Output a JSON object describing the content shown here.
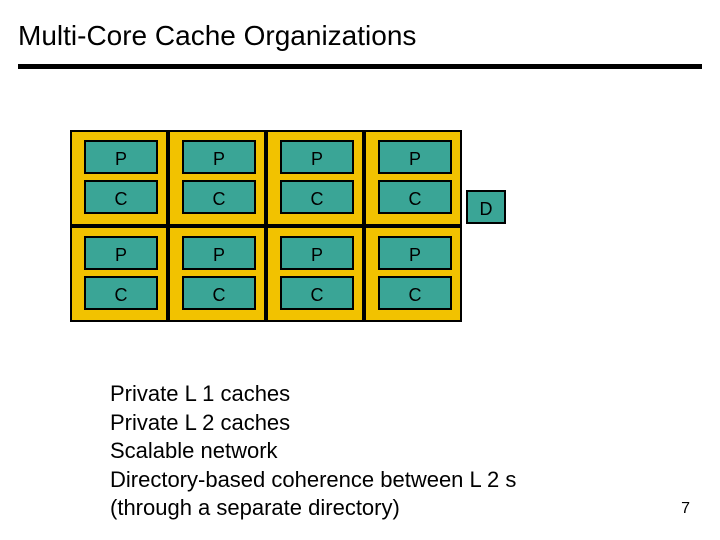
{
  "title": "Multi-Core Cache Organizations",
  "labels": {
    "P": "P",
    "C": "C",
    "D": "D"
  },
  "grid": {
    "rows": 2,
    "cols": 4,
    "cellW": 98,
    "cellH": 96
  },
  "description": [
    "Private L 1 caches",
    "Private L 2 caches",
    "Scalable network",
    "Directory-based coherence between L 2 s",
    " (through a separate directory)"
  ],
  "pageNumber": "7"
}
